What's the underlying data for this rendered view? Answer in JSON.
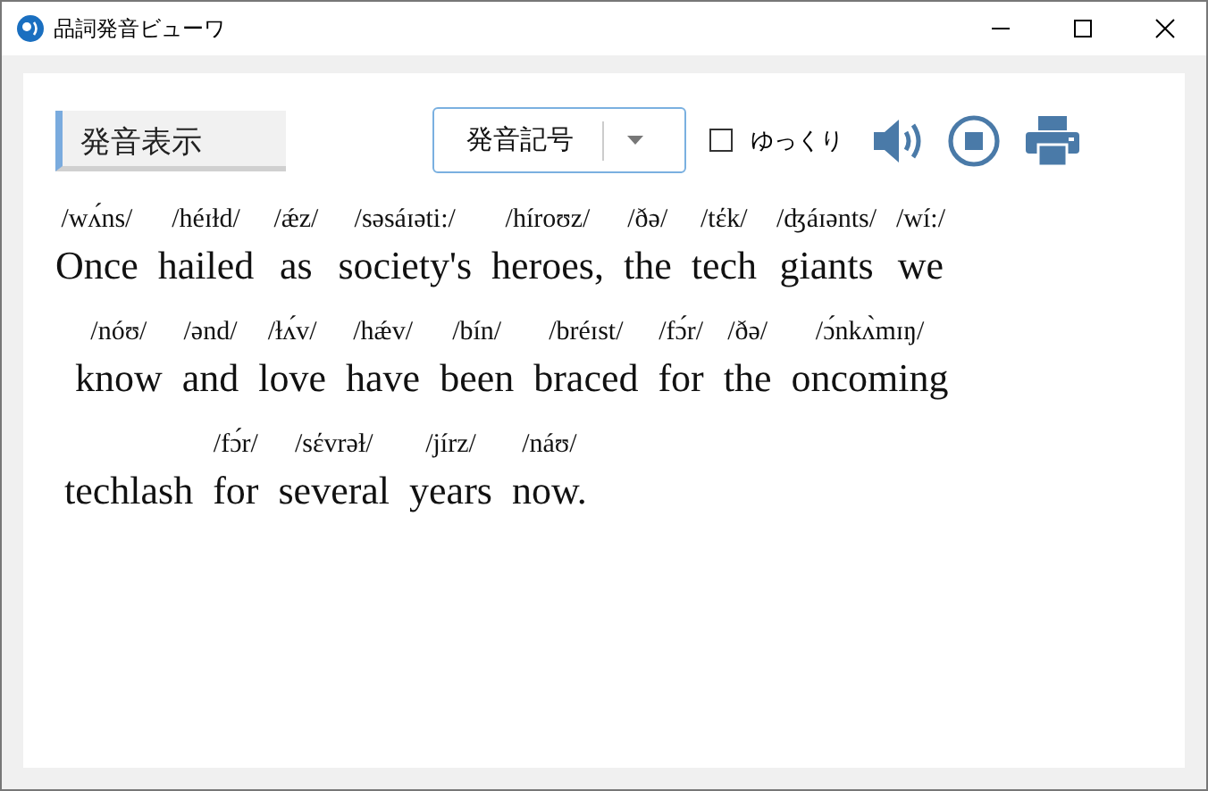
{
  "window": {
    "title": "品詞発音ビューワ"
  },
  "heading": "発音表示",
  "dropdown": {
    "value": "発音記号"
  },
  "slow": {
    "label": "ゆっくり",
    "checked": false
  },
  "lines": [
    {
      "words": [
        {
          "ipa": "/wʌ́ns/",
          "text": "Once"
        },
        {
          "ipa": "/héɪɫd/",
          "text": "hailed"
        },
        {
          "ipa": "/ǽz/",
          "text": "as"
        },
        {
          "ipa": "/səsáɪəti:/",
          "text": "society's"
        },
        {
          "ipa": "/híroʊz/",
          "text": "heroes,"
        },
        {
          "ipa": "/ðə/",
          "text": "the"
        },
        {
          "ipa": "/tέk/",
          "text": "tech"
        },
        {
          "ipa": "/ʤáɪənts/",
          "text": "giants"
        },
        {
          "ipa": "/wí:/",
          "text": "we"
        }
      ]
    },
    {
      "words": [
        {
          "ipa": "/nóʊ/",
          "text": "know"
        },
        {
          "ipa": "/ənd/",
          "text": "and"
        },
        {
          "ipa": "/ɫʌ́v/",
          "text": "love"
        },
        {
          "ipa": "/hǽv/",
          "text": "have"
        },
        {
          "ipa": "/bín/",
          "text": "been"
        },
        {
          "ipa": "/bréɪst/",
          "text": "braced"
        },
        {
          "ipa": "/fɔ́r/",
          "text": "for"
        },
        {
          "ipa": "/ðə/",
          "text": "the"
        },
        {
          "ipa": "/ɔ́nkʌ̀mɪŋ/",
          "text": "oncoming"
        }
      ]
    },
    {
      "words": [
        {
          "text": "techlash"
        },
        {
          "ipa": "/fɔ́r/",
          "text": "for"
        },
        {
          "ipa": "/sέvrəɫ/",
          "text": "several"
        },
        {
          "ipa": "/jírz/",
          "text": "years"
        },
        {
          "ipa": "/náʊ/",
          "text": "now."
        }
      ]
    }
  ]
}
